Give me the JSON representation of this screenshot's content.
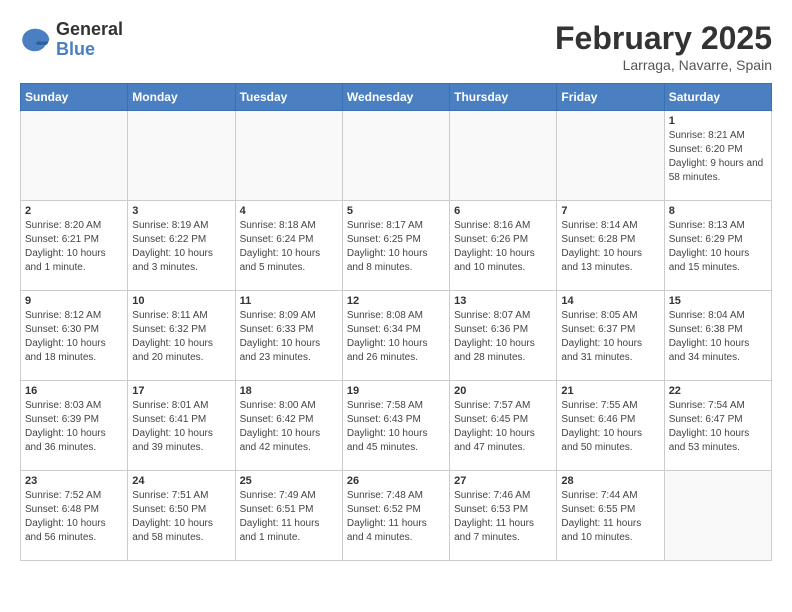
{
  "logo": {
    "general": "General",
    "blue": "Blue"
  },
  "header": {
    "month_year": "February 2025",
    "location": "Larraga, Navarre, Spain"
  },
  "weekdays": [
    "Sunday",
    "Monday",
    "Tuesday",
    "Wednesday",
    "Thursday",
    "Friday",
    "Saturday"
  ],
  "weeks": [
    [
      {
        "day": "",
        "info": ""
      },
      {
        "day": "",
        "info": ""
      },
      {
        "day": "",
        "info": ""
      },
      {
        "day": "",
        "info": ""
      },
      {
        "day": "",
        "info": ""
      },
      {
        "day": "",
        "info": ""
      },
      {
        "day": "1",
        "info": "Sunrise: 8:21 AM\nSunset: 6:20 PM\nDaylight: 9 hours and 58 minutes."
      }
    ],
    [
      {
        "day": "2",
        "info": "Sunrise: 8:20 AM\nSunset: 6:21 PM\nDaylight: 10 hours and 1 minute."
      },
      {
        "day": "3",
        "info": "Sunrise: 8:19 AM\nSunset: 6:22 PM\nDaylight: 10 hours and 3 minutes."
      },
      {
        "day": "4",
        "info": "Sunrise: 8:18 AM\nSunset: 6:24 PM\nDaylight: 10 hours and 5 minutes."
      },
      {
        "day": "5",
        "info": "Sunrise: 8:17 AM\nSunset: 6:25 PM\nDaylight: 10 hours and 8 minutes."
      },
      {
        "day": "6",
        "info": "Sunrise: 8:16 AM\nSunset: 6:26 PM\nDaylight: 10 hours and 10 minutes."
      },
      {
        "day": "7",
        "info": "Sunrise: 8:14 AM\nSunset: 6:28 PM\nDaylight: 10 hours and 13 minutes."
      },
      {
        "day": "8",
        "info": "Sunrise: 8:13 AM\nSunset: 6:29 PM\nDaylight: 10 hours and 15 minutes."
      }
    ],
    [
      {
        "day": "9",
        "info": "Sunrise: 8:12 AM\nSunset: 6:30 PM\nDaylight: 10 hours and 18 minutes."
      },
      {
        "day": "10",
        "info": "Sunrise: 8:11 AM\nSunset: 6:32 PM\nDaylight: 10 hours and 20 minutes."
      },
      {
        "day": "11",
        "info": "Sunrise: 8:09 AM\nSunset: 6:33 PM\nDaylight: 10 hours and 23 minutes."
      },
      {
        "day": "12",
        "info": "Sunrise: 8:08 AM\nSunset: 6:34 PM\nDaylight: 10 hours and 26 minutes."
      },
      {
        "day": "13",
        "info": "Sunrise: 8:07 AM\nSunset: 6:36 PM\nDaylight: 10 hours and 28 minutes."
      },
      {
        "day": "14",
        "info": "Sunrise: 8:05 AM\nSunset: 6:37 PM\nDaylight: 10 hours and 31 minutes."
      },
      {
        "day": "15",
        "info": "Sunrise: 8:04 AM\nSunset: 6:38 PM\nDaylight: 10 hours and 34 minutes."
      }
    ],
    [
      {
        "day": "16",
        "info": "Sunrise: 8:03 AM\nSunset: 6:39 PM\nDaylight: 10 hours and 36 minutes."
      },
      {
        "day": "17",
        "info": "Sunrise: 8:01 AM\nSunset: 6:41 PM\nDaylight: 10 hours and 39 minutes."
      },
      {
        "day": "18",
        "info": "Sunrise: 8:00 AM\nSunset: 6:42 PM\nDaylight: 10 hours and 42 minutes."
      },
      {
        "day": "19",
        "info": "Sunrise: 7:58 AM\nSunset: 6:43 PM\nDaylight: 10 hours and 45 minutes."
      },
      {
        "day": "20",
        "info": "Sunrise: 7:57 AM\nSunset: 6:45 PM\nDaylight: 10 hours and 47 minutes."
      },
      {
        "day": "21",
        "info": "Sunrise: 7:55 AM\nSunset: 6:46 PM\nDaylight: 10 hours and 50 minutes."
      },
      {
        "day": "22",
        "info": "Sunrise: 7:54 AM\nSunset: 6:47 PM\nDaylight: 10 hours and 53 minutes."
      }
    ],
    [
      {
        "day": "23",
        "info": "Sunrise: 7:52 AM\nSunset: 6:48 PM\nDaylight: 10 hours and 56 minutes."
      },
      {
        "day": "24",
        "info": "Sunrise: 7:51 AM\nSunset: 6:50 PM\nDaylight: 10 hours and 58 minutes."
      },
      {
        "day": "25",
        "info": "Sunrise: 7:49 AM\nSunset: 6:51 PM\nDaylight: 11 hours and 1 minute."
      },
      {
        "day": "26",
        "info": "Sunrise: 7:48 AM\nSunset: 6:52 PM\nDaylight: 11 hours and 4 minutes."
      },
      {
        "day": "27",
        "info": "Sunrise: 7:46 AM\nSunset: 6:53 PM\nDaylight: 11 hours and 7 minutes."
      },
      {
        "day": "28",
        "info": "Sunrise: 7:44 AM\nSunset: 6:55 PM\nDaylight: 11 hours and 10 minutes."
      },
      {
        "day": "",
        "info": ""
      }
    ]
  ]
}
